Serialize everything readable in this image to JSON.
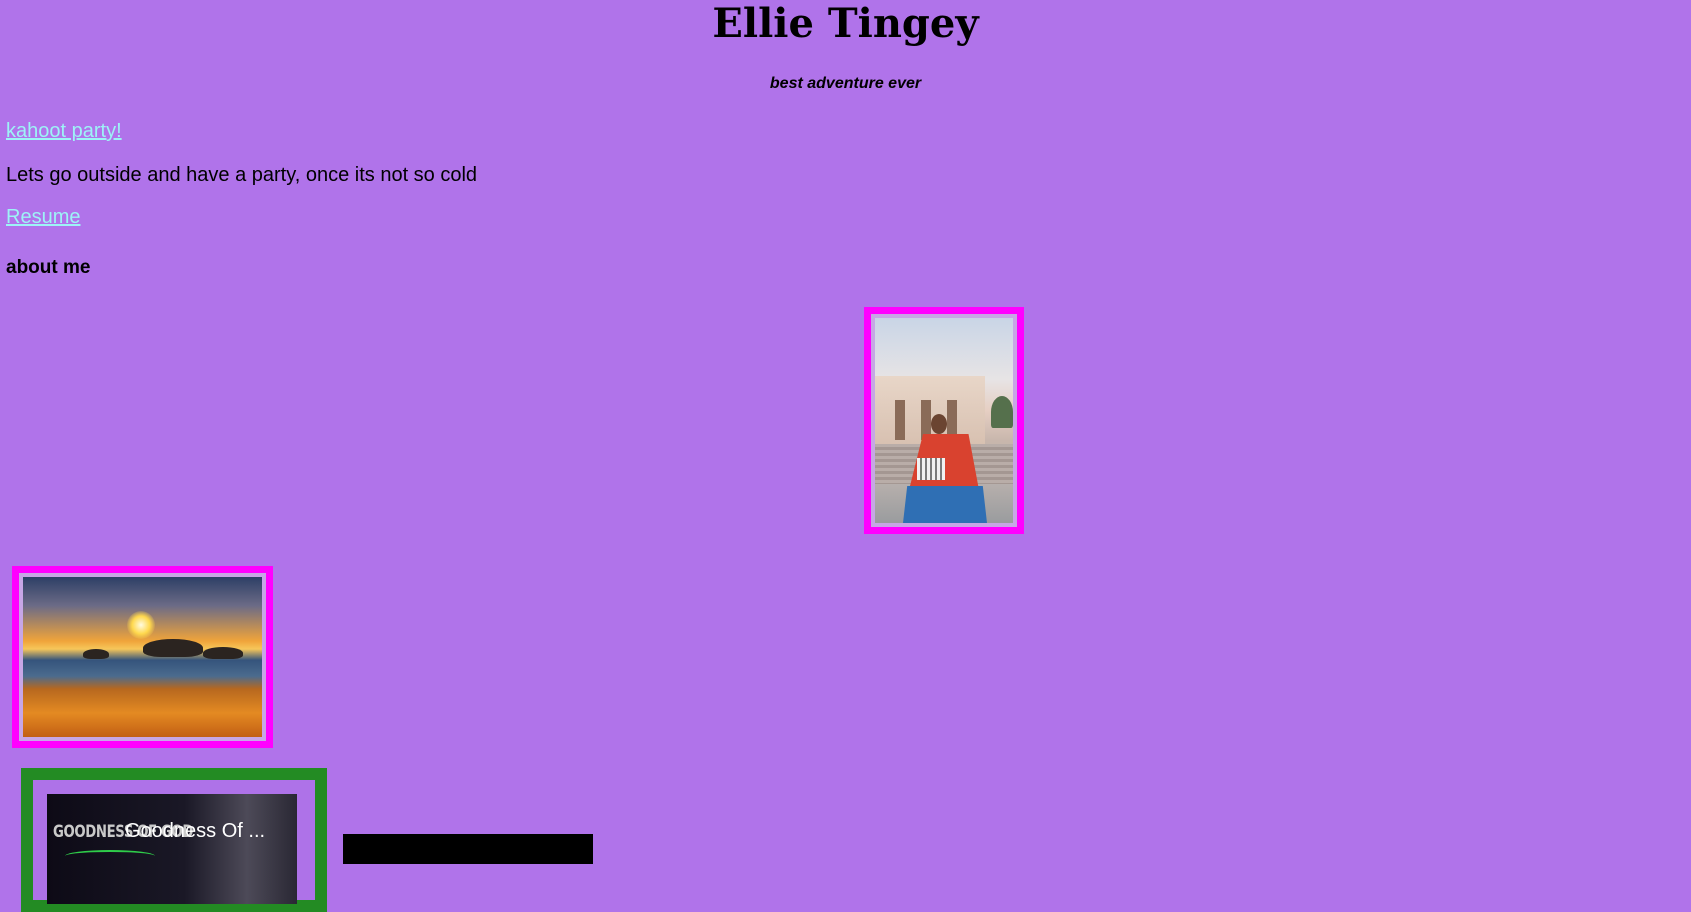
{
  "header": {
    "title": "Ellie Tingey",
    "tagline": "best adventure ever"
  },
  "content": {
    "party_link": "kahoot party!",
    "party_text": "Lets go outside and have a party, once its not so cold",
    "resume_link": "Resume",
    "about_heading": "about me"
  },
  "images": {
    "portrait": {
      "alt": "Ellie in front of the temple with a flag"
    },
    "sunset": {
      "alt": "Sunset over the beach"
    }
  },
  "video": {
    "title": "Goodness Of ...",
    "thumbnail_text": "GOODNESS OF GOD"
  },
  "colors": {
    "background": "#b073ea",
    "link": "#9df3f6",
    "image_border": "#ff00ff",
    "video_border": "#238b23"
  }
}
